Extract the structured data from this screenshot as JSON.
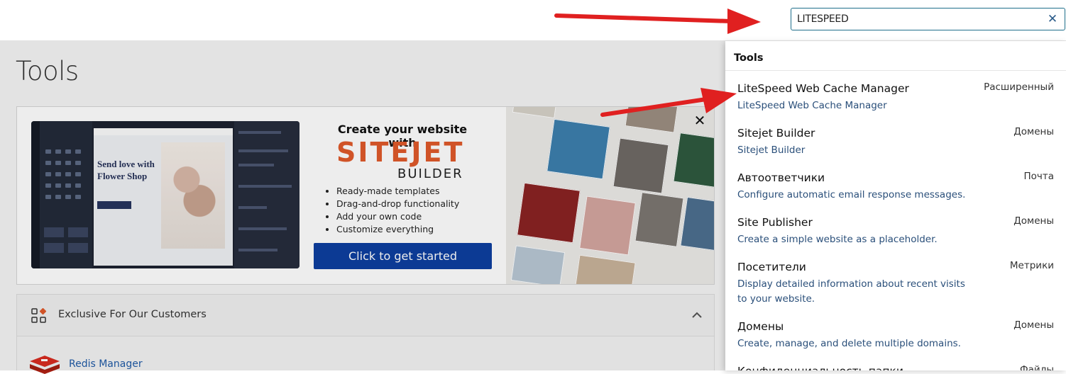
{
  "search": {
    "value": "LITESPEED",
    "clear_icon": "close-icon"
  },
  "page": {
    "title": "Tools"
  },
  "banner": {
    "mock": {
      "headline": "Send love with Flower Shop",
      "shop_name": "Flower shop"
    },
    "heading": "Create your website with",
    "brand": "SITEJET",
    "brand_sub": "BUILDER",
    "features": [
      "Ready-made templates",
      "Drag-and-drop functionality",
      "Add your own code",
      "Customize everything"
    ],
    "cta_label": "Click to get started",
    "close_label": "✕",
    "brand_color": "#e05a2a",
    "cta_color": "#0d3fa0"
  },
  "exclusive": {
    "label": "Exclusive For Our Customers",
    "items": [
      {
        "label": "Redis Manager"
      }
    ]
  },
  "dropdown": {
    "header": "Tools",
    "items": [
      {
        "title": "LiteSpeed Web Cache Manager",
        "desc": "LiteSpeed Web Cache Manager",
        "category": "Расширенный"
      },
      {
        "title": "Sitejet Builder",
        "desc": "Sitejet Builder",
        "category": "Домены"
      },
      {
        "title": "Автоответчики",
        "desc": "Configure automatic email response messages.",
        "category": "Почта"
      },
      {
        "title": "Site Publisher",
        "desc": "Create a simple website as a placeholder.",
        "category": "Домены"
      },
      {
        "title": "Посетители",
        "desc": "Display detailed information about recent visits to your website.",
        "category": "Метрики"
      },
      {
        "title": "Домены",
        "desc": "Create, manage, and delete multiple domains.",
        "category": "Домены"
      },
      {
        "title": "Конфиденциальность папки",
        "desc": "",
        "category": "Файлы"
      }
    ]
  },
  "annotations": {
    "arrow_color": "#e02020"
  }
}
